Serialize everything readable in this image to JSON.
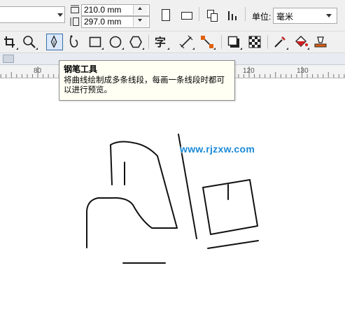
{
  "property_bar": {
    "width_value": "210.0 mm",
    "height_value": "297.0 mm",
    "units_label": "单位:",
    "units_value": "毫米"
  },
  "toolbar": {
    "tools": [
      "crop-tool",
      "zoom-tool",
      "pen-tool",
      "bspline-tool",
      "rectangle-tool",
      "ellipse-tool",
      "polygon-tool",
      "text-tool",
      "dimension-tool",
      "connector-tool",
      "drop-shadow-tool",
      "transparency-tool",
      "eyedropper-tool",
      "fill-tool",
      "smart-fill-tool"
    ],
    "active_tool": "pen-tool"
  },
  "ruler": {
    "labels": [
      "80",
      "120",
      "130"
    ]
  },
  "tooltip": {
    "title": "钢笔工具",
    "description": "将曲线绘制成多条线段，每画一条线段时都可以进行预览。"
  },
  "watermark": "www.rjzxw.com",
  "colors": {
    "accent": "#3a6ea5",
    "tooltip_bg": "#fffff4",
    "watermark": "#1a8ad8"
  }
}
